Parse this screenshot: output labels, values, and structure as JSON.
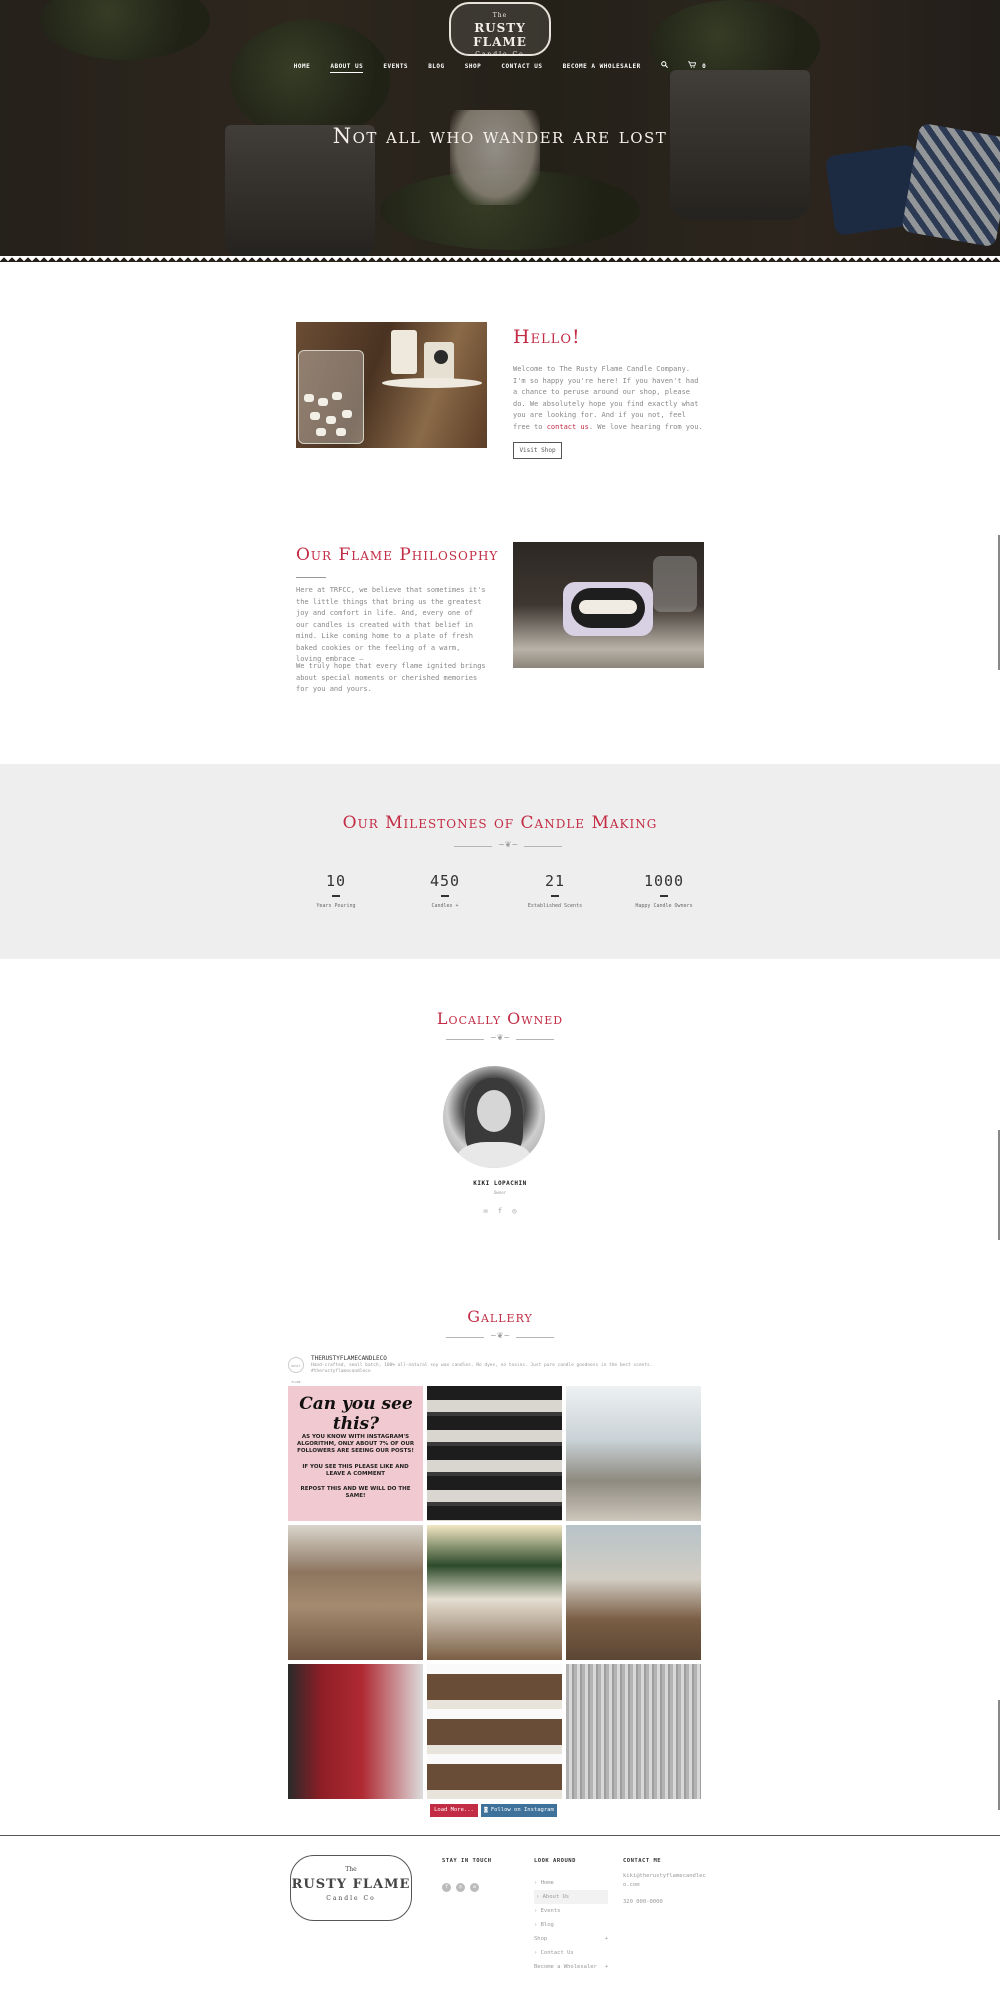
{
  "brand": {
    "top_line": "The",
    "name": "RUSTY FLAME",
    "sub_line": "Candle Co"
  },
  "nav": {
    "items": [
      "HOME",
      "ABOUT US",
      "EVENTS",
      "BLOG",
      "SHOP",
      "CONTACT US",
      "BECOME A WHOLESALER"
    ],
    "active": "ABOUT US",
    "cart_count": "0"
  },
  "hero": {
    "title": "Not all who wander are lost"
  },
  "hello": {
    "heading": "Hello!",
    "text_before": "Welcome to The Rusty Flame Candle Company. I'm so happy you're here! If you haven't had a chance to peruse around our shop, please do. We absolutely hope you find exactly what you are looking for. And if you not, feel free to ",
    "link": "contact us",
    "text_after": ". We love hearing from you.",
    "button": "Visit Shop"
  },
  "philosophy": {
    "heading": "Our Flame Philosophy",
    "p1": "Here at TRFCC, we believe that sometimes it's the little things that bring us the greatest joy and comfort in life. And, every one of our candles is created with that belief in mind. Like coming home to a plate of fresh baked cookies or the feeling of a warm, loving embrace –",
    "p2": "We truly hope that every flame ignited brings about special moments or cherished memories for you and yours."
  },
  "milestones": {
    "heading": "Our Milestones of Candle Making",
    "counters": [
      {
        "value": "10",
        "label": "Years Pouring"
      },
      {
        "value": "450",
        "label": "Candles +"
      },
      {
        "value": "21",
        "label": "Established Scents"
      },
      {
        "value": "1000",
        "label": "Happy Candle Owners"
      }
    ]
  },
  "owner_section": {
    "heading": "Locally Owned",
    "name": "KIKI LOPACHIN",
    "role": "Owner"
  },
  "gallery": {
    "heading": "Gallery",
    "username": "THERUSTYFLAMECANDLECO",
    "bio": "Hand-crafted, small batch, 100% all-natural soy wax candles. No dyes, no toxins. Just pure candle goodness in the best scents. #therustyflamecandleco",
    "avatar_text": "RUSTY FLAME",
    "tile1": {
      "headline": "Can you see this?",
      "line1": "AS YOU KNOW WITH INSTAGRAM'S ALGORITHM, ONLY ABOUT 7% OF OUR FOLLOWERS ARE SEEING OUR POSTS!",
      "line2": "IF YOU SEE THIS PLEASE LIKE AND LEAVE A COMMENT",
      "line3": "REPOST THIS AND WE WILL DO THE SAME!"
    },
    "load_more": "Load More...",
    "follow": "Follow on Instagram"
  },
  "footer": {
    "stay_in_touch": "STAY IN TOUCH",
    "look_around": "LOOK AROUND",
    "contact_me": "CONTACT ME",
    "menu": [
      "› Home",
      "› About Us",
      "› Events",
      "› Blog",
      "Shop",
      "› Contact Us",
      "Become a Wholesaler"
    ],
    "email": "kiki@therustyflamecandleco.com",
    "phone": "320 000-0000"
  }
}
